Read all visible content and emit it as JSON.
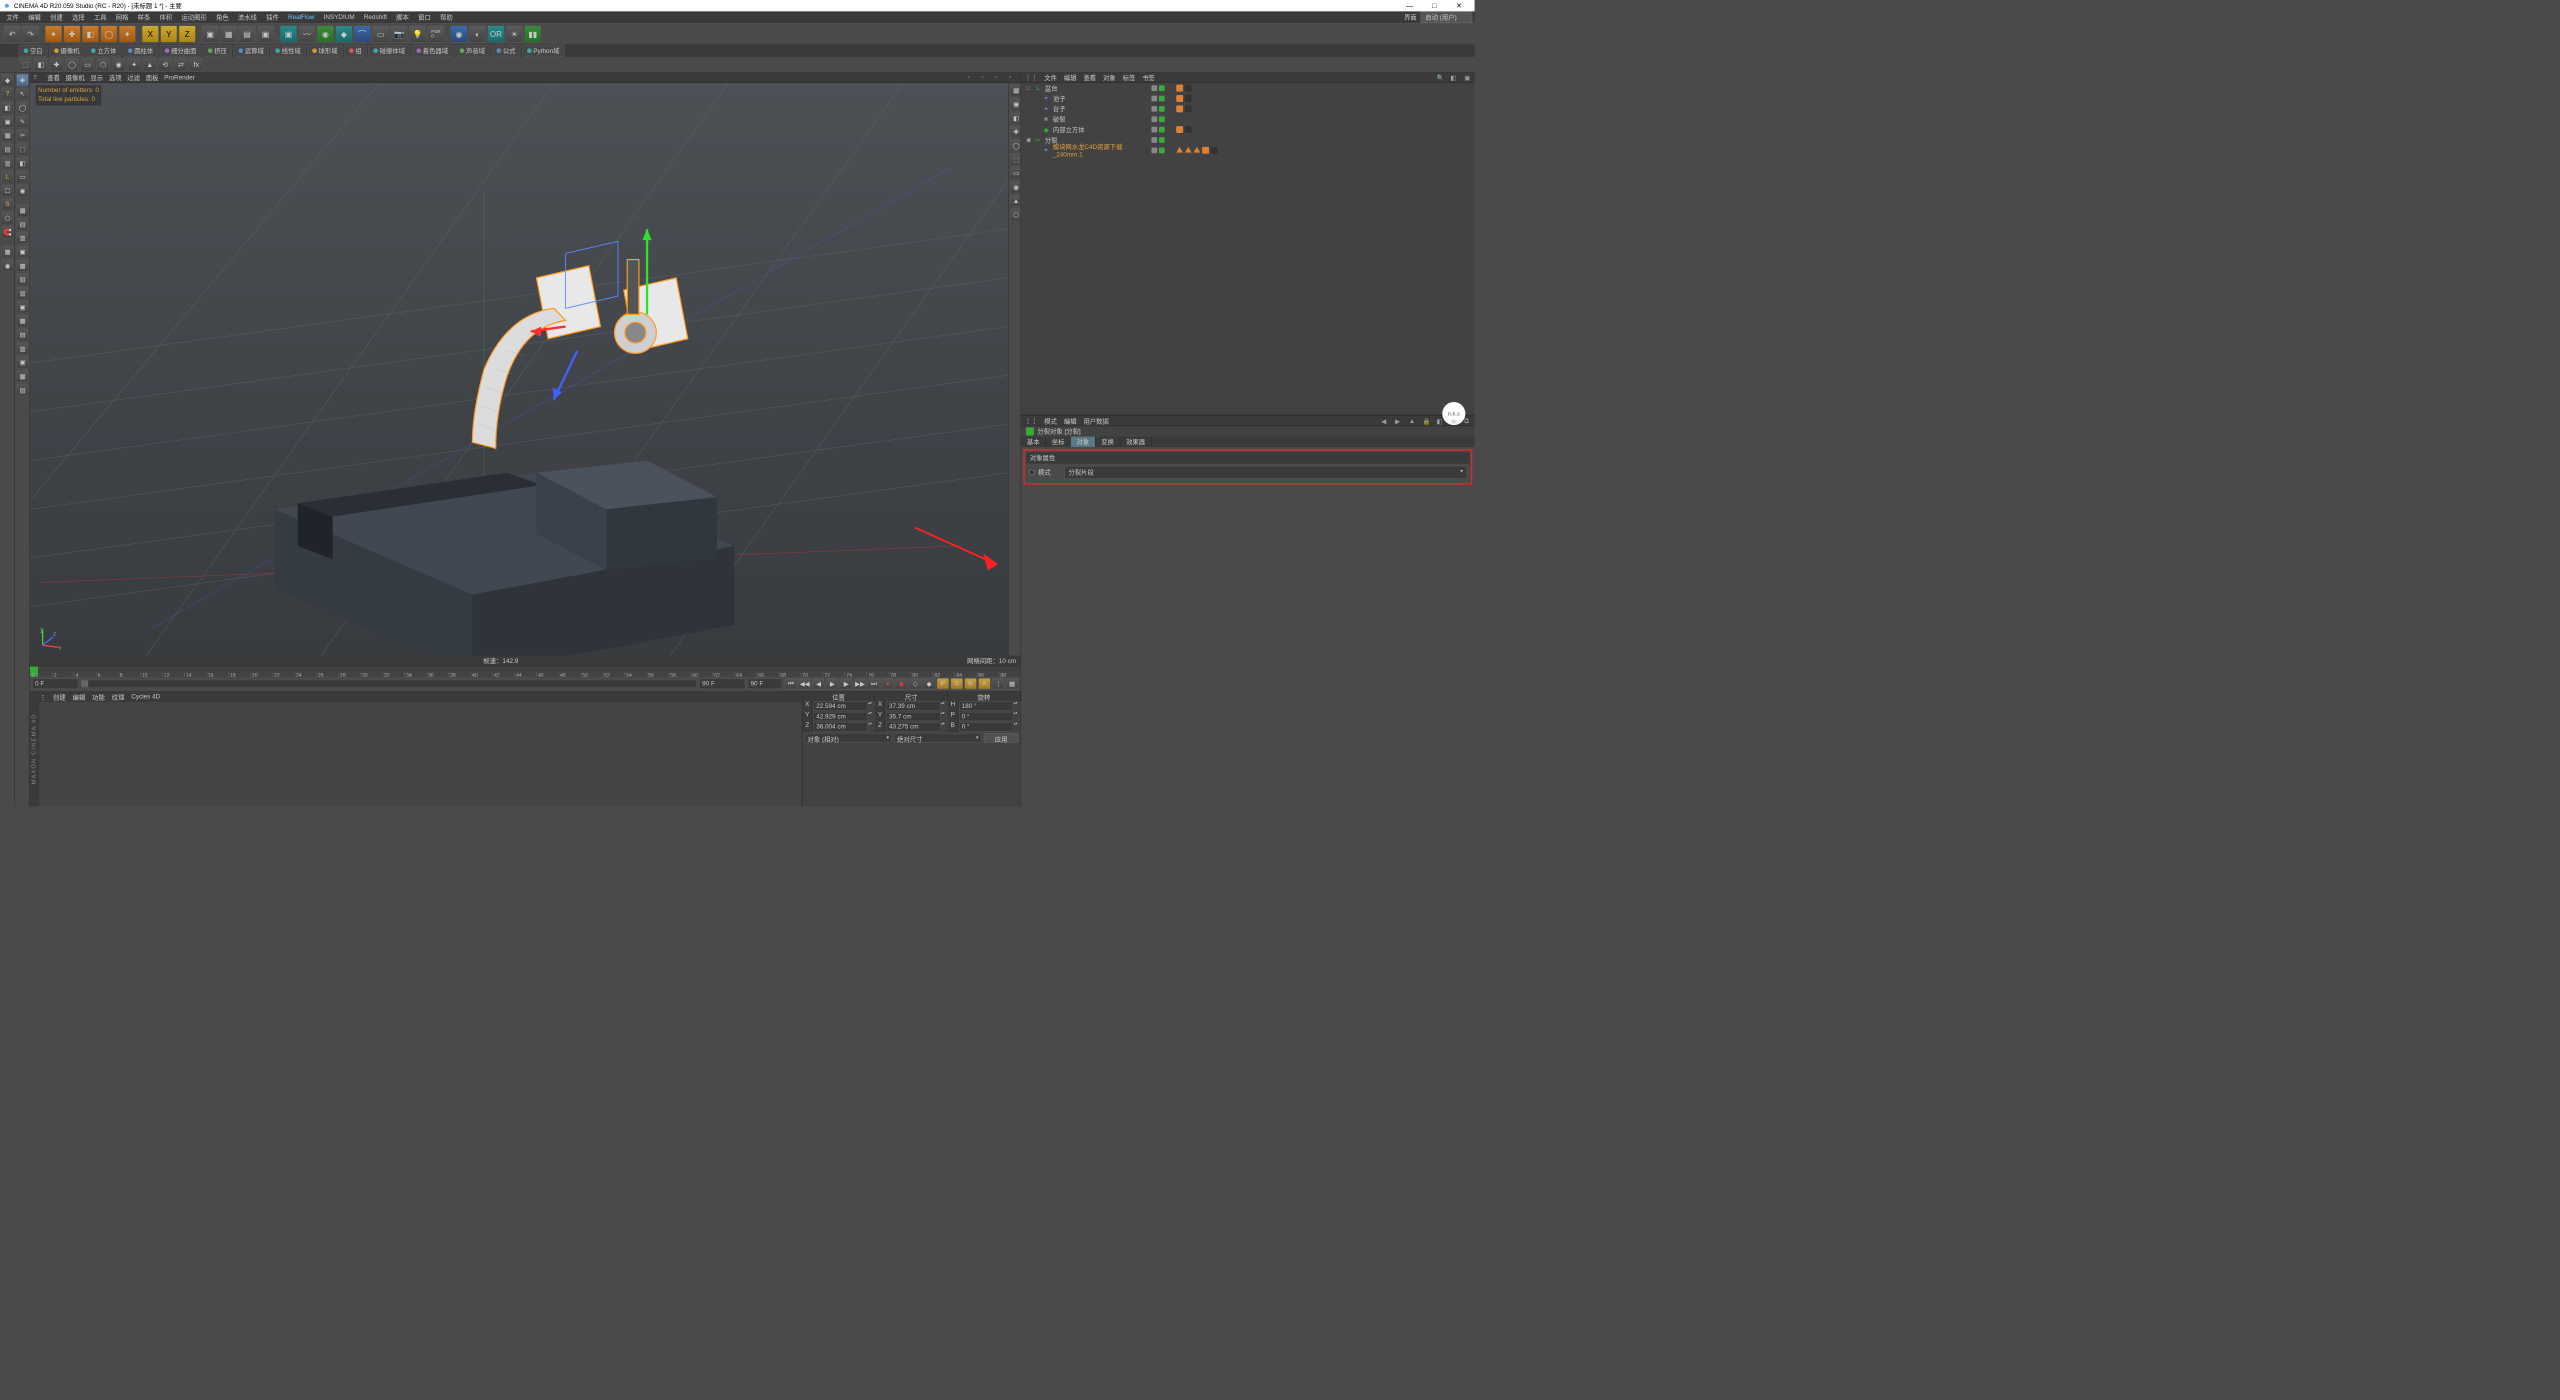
{
  "window": {
    "title": "CINEMA 4D R20.059 Studio (RC - R20) - [未标题 1 *] - 主要",
    "min": "—",
    "max": "□",
    "close": "✕"
  },
  "menu": {
    "items": [
      "文件",
      "编辑",
      "创建",
      "选择",
      "工具",
      "网格",
      "样条",
      "体积",
      "运动图形",
      "角色",
      "流水线",
      "插件",
      "RealFlow",
      "INSYDIUM",
      "Redshift",
      "脚本",
      "窗口",
      "帮助"
    ],
    "highlighted": "RealFlow",
    "layout_label": "界面",
    "layout_value": "启动 (用户)"
  },
  "sec_toolbar": [
    "空白",
    "摄像机",
    "立方体",
    "圆柱体",
    "细分曲面",
    "挤压",
    "运算域",
    "线性域",
    "球形域",
    "组",
    "碰撞体域",
    "着色器域",
    "声音域",
    "公式",
    "Python域"
  ],
  "view_header": {
    "items": [
      "查看",
      "摄像机",
      "显示",
      "选项",
      "过滤",
      "面板",
      "ProRender"
    ]
  },
  "emitters": {
    "line1": "Number of emitters: 0",
    "line2": "Total live particles: 0"
  },
  "view_status": {
    "hud": "帧速：142.9",
    "grid": "网格间距：10 cm"
  },
  "obj_header": {
    "items": [
      "文件",
      "编辑",
      "查看",
      "对象",
      "标签",
      "书签"
    ]
  },
  "objects": [
    {
      "indent": 0,
      "exp": "□",
      "icon": "L",
      "iconColor": "#3aaaa0",
      "name": "盆台",
      "sel": false,
      "tags": [
        "orange",
        "dark"
      ]
    },
    {
      "indent": 1,
      "exp": "",
      "icon": "⌖",
      "iconColor": "#6aa0ff",
      "name": "池子",
      "sel": false,
      "tags": [
        "orange",
        "dark"
      ]
    },
    {
      "indent": 1,
      "exp": "",
      "icon": "⌖",
      "iconColor": "#6aa0ff",
      "name": "台子",
      "sel": false,
      "tags": [
        "orange",
        "dark"
      ]
    },
    {
      "indent": 1,
      "exp": "",
      "icon": "■",
      "iconColor": "#888",
      "name": "破裂",
      "sel": false,
      "tags": []
    },
    {
      "indent": 1,
      "exp": "",
      "icon": "◆",
      "iconColor": "#3aaa3a",
      "name": "内部立方体",
      "sel": false,
      "tags": [
        "orange",
        "dark"
      ]
    },
    {
      "indent": 0,
      "exp": "▣",
      "icon": "✂",
      "iconColor": "#3aaa3a",
      "name": "分裂",
      "sel": false,
      "tags": []
    },
    {
      "indent": 1,
      "exp": "",
      "icon": "⌖",
      "iconColor": "#6aa0ff",
      "name": "模块网水龙C4D资源下载_240mm.1",
      "sel": true,
      "tags": [
        "tri",
        "tri",
        "tri",
        "orange",
        "dark"
      ]
    }
  ],
  "attr_header": {
    "items": [
      "模式",
      "编辑",
      "用户数据"
    ]
  },
  "attr_title": "分裂对象 [分裂]",
  "attr_tabs": [
    "基本",
    "坐标",
    "对象",
    "变换",
    "效果器"
  ],
  "attr_active_tab": "对象",
  "attr_section": "对象属性",
  "attr_prop": {
    "label": "模式",
    "value": "分裂片段"
  },
  "attr_badge": "n.k.s",
  "timeline": {
    "start": "0 F",
    "current": "0 F",
    "end": "90 F",
    "end2": "90 F",
    "ticks": [
      0,
      2,
      4,
      6,
      8,
      10,
      12,
      14,
      16,
      18,
      20,
      22,
      24,
      26,
      28,
      30,
      32,
      34,
      36,
      38,
      40,
      42,
      44,
      46,
      48,
      50,
      52,
      54,
      56,
      58,
      60,
      62,
      64,
      66,
      68,
      70,
      72,
      74,
      76,
      78,
      80,
      82,
      84,
      86,
      88,
      90
    ]
  },
  "mat_header": {
    "items": [
      "创建",
      "编辑",
      "功能",
      "纹理",
      "Cycles 4D"
    ]
  },
  "coord": {
    "headers": [
      "位置",
      "尺寸",
      "旋转"
    ],
    "rows": [
      {
        "axis": "X",
        "pos": "22.594 cm",
        "size": "37.39 cm",
        "rlabel": "H",
        "rot": "180 °"
      },
      {
        "axis": "Y",
        "pos": "42.929 cm",
        "size": "35.7 cm",
        "rlabel": "P",
        "rot": "0 °"
      },
      {
        "axis": "Z",
        "pos": "36.004 cm",
        "size": "43.275 cm",
        "rlabel": "B",
        "rot": "0 °"
      }
    ],
    "sel1": "对象 (相对)",
    "sel2": "绝对尺寸",
    "apply": "应用"
  },
  "brand": "MAXON CINEMA 4D"
}
